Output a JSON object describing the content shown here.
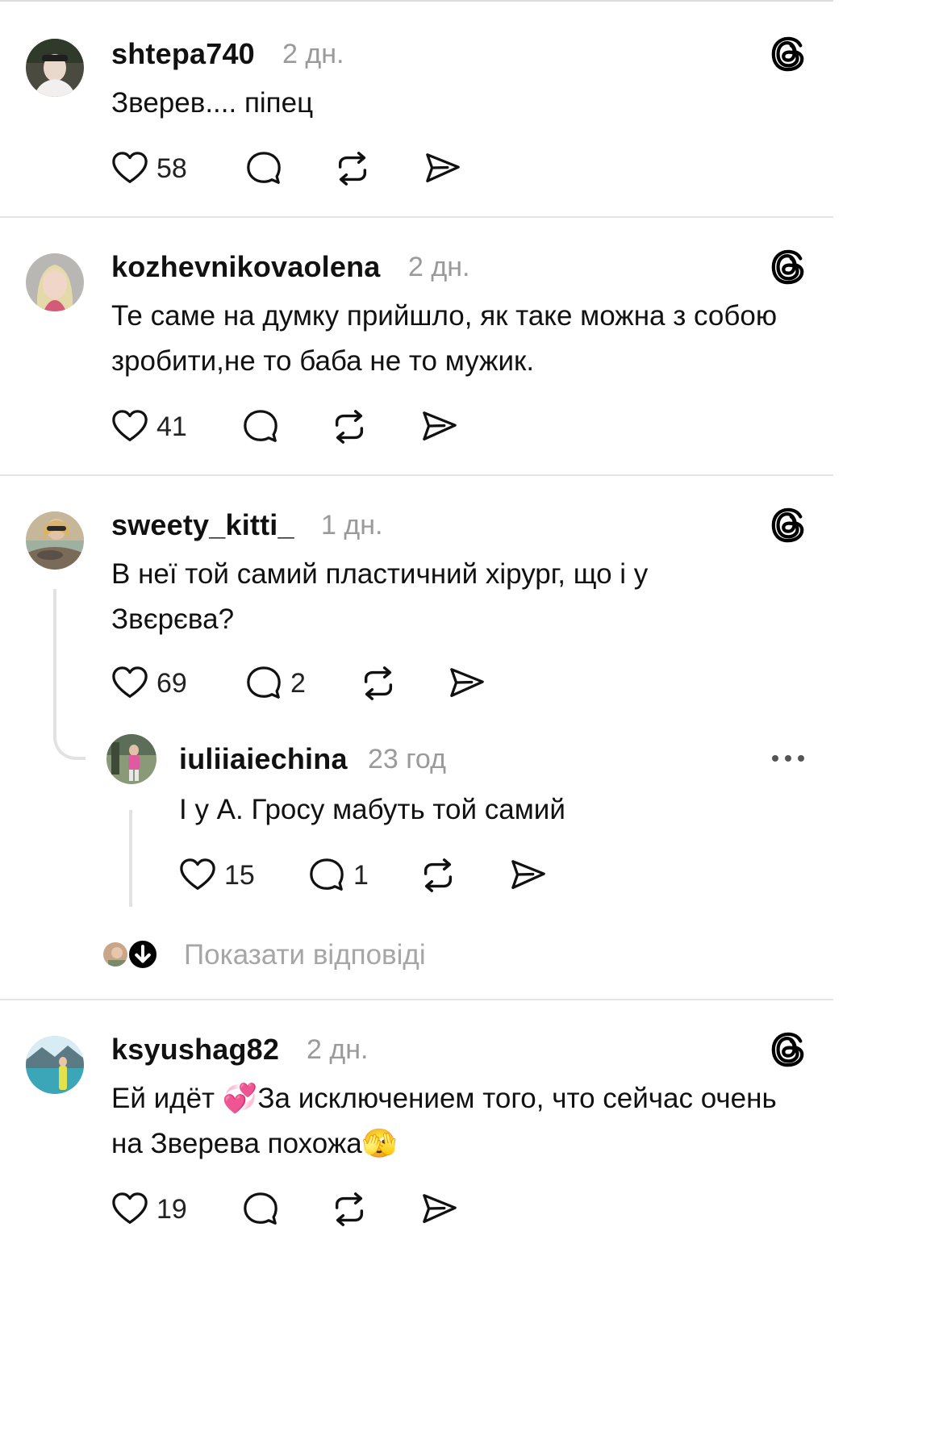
{
  "posts": [
    {
      "username": "shtepa740",
      "time": "2 дн.",
      "text": "Зверев.... піпец",
      "likes": "58",
      "replies": ""
    },
    {
      "username": "kozhevnikovaolena",
      "time": "2 дн.",
      "text": "Те саме на думку прийшло, як таке можна з собою зробити,не то баба не то мужик.",
      "likes": "41",
      "replies": ""
    },
    {
      "username": "sweety_kitti_",
      "time": "1 дн.",
      "text": "В неї той самий пластичний хірург, що і у Звєрєва?",
      "likes": "69",
      "replies": "2"
    },
    {
      "username": "ksyushag82",
      "time": "2 дн.",
      "text": "Ей  идёт 💞За исключением того, что сейчас очень на Зверева похожа🫣",
      "likes": "19",
      "replies": ""
    }
  ],
  "reply": {
    "username": "iuliiaiechina",
    "time": "23 год",
    "text": "І у А. Гросу мабуть той самий",
    "likes": "15",
    "replies": "1"
  },
  "show_replies_label": "Показати відповіді",
  "colors": {
    "text": "#111111",
    "muted": "#9a9a9a",
    "divider": "#e3e3e3"
  },
  "icons": [
    "threads-logo-icon",
    "heart-icon",
    "comment-icon",
    "repost-icon",
    "share-icon",
    "more-dots-icon",
    "arrow-down-icon"
  ]
}
